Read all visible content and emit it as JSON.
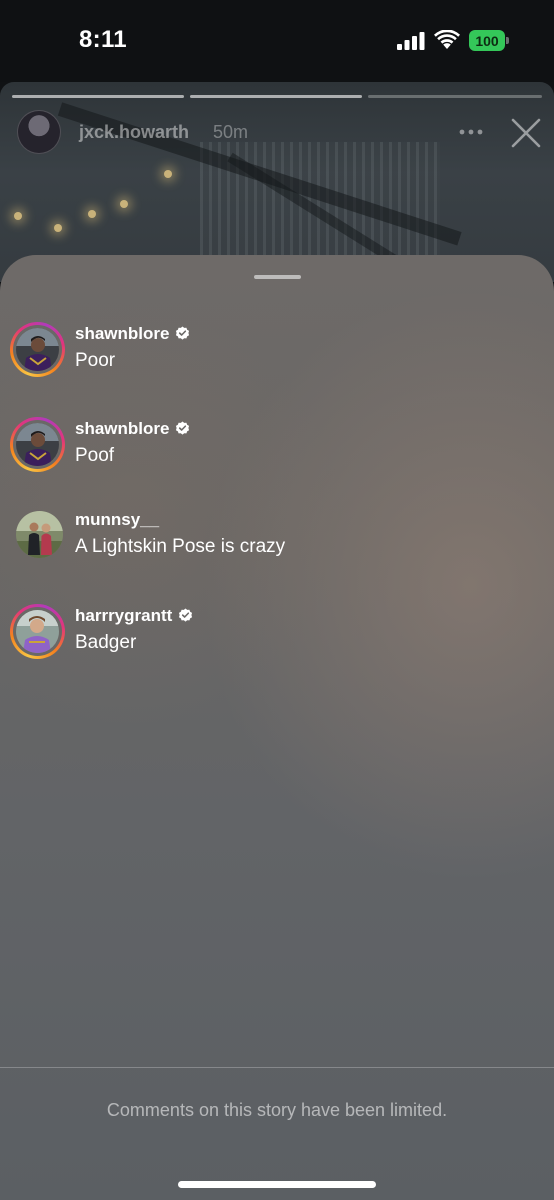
{
  "status_bar": {
    "time": "8:11",
    "battery_level": "100",
    "battery_color": "#34c759"
  },
  "story": {
    "username": "jxck.howarth",
    "time_ago": "50m",
    "progress_segments": 3,
    "more_icon": "more-horizontal-icon",
    "close_icon": "close-icon"
  },
  "comments": [
    {
      "username": "shawnblore",
      "verified": true,
      "text": "Poor",
      "story_ring": true,
      "avatar_theme": "purple-jersey"
    },
    {
      "username": "shawnblore",
      "verified": true,
      "text": "Poof",
      "story_ring": true,
      "avatar_theme": "purple-jersey"
    },
    {
      "username": "munnsy__",
      "verified": false,
      "text": "A Lightskin Pose is crazy",
      "story_ring": false,
      "avatar_theme": "couple-outdoor"
    },
    {
      "username": "harrrygrantt",
      "verified": true,
      "text": "Badger",
      "story_ring": true,
      "avatar_theme": "purple-jersey-light"
    }
  ],
  "footer": {
    "note": "Comments on this story have been limited."
  },
  "colors": {
    "story_ring_gradient": [
      "#f9c443",
      "#f4831f",
      "#e2357b",
      "#b03bbd"
    ],
    "sheet_background": "#666668"
  }
}
